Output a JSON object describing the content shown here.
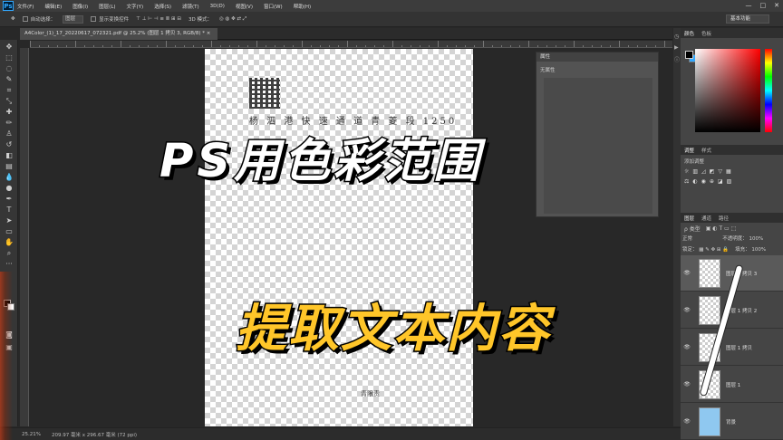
{
  "app": {
    "logo": "Ps"
  },
  "menu": [
    "文件(F)",
    "编辑(E)",
    "图像(I)",
    "图层(L)",
    "文字(Y)",
    "选择(S)",
    "滤镜(T)",
    "3D(D)",
    "视图(V)",
    "窗口(W)",
    "帮助(H)"
  ],
  "window_controls": [
    "—",
    "□",
    "✕"
  ],
  "options": {
    "auto_select": "自动选择：",
    "auto_select_value": "图层",
    "show_transform": "显示变换控件",
    "mode_3d": "3D 模式："
  },
  "workspace": "基本功能",
  "document": {
    "tab_title": "A4Color_(1)_17_20220617_072321.pdf @ 25.2% (图层 1 拷贝 3, RGB/8) *",
    "close": "×"
  },
  "doc_content": {
    "line1": "杨 泗 港 快 速 通 道 青 菱 段 1250",
    "line2": "青限责"
  },
  "properties": {
    "title": "属性",
    "body": "无属性"
  },
  "color_panel": {
    "tabs": [
      "颜色",
      "色板"
    ]
  },
  "adjust_panel": {
    "tabs": [
      "调整",
      "样式"
    ],
    "label": "添加调整"
  },
  "layers_panel": {
    "tabs": [
      "图层",
      "通道",
      "路径"
    ],
    "filter": "ρ 类型",
    "blend_mode": "正常",
    "opacity_label": "不透明度：",
    "opacity_value": "100%",
    "lock_label": "锁定：",
    "fill_label": "填充：",
    "fill_value": "100%",
    "layers": [
      {
        "name": "图层 1 拷贝 3",
        "selected": true
      },
      {
        "name": "图层 1 拷贝 2",
        "selected": false
      },
      {
        "name": "图层 1 拷贝",
        "selected": false
      },
      {
        "name": "图层 1",
        "selected": false
      },
      {
        "name": "背景",
        "selected": false
      }
    ]
  },
  "status": {
    "zoom": "25.21%",
    "doc_size": "209.97 毫米 x 296.67 毫米 (72 ppi)"
  },
  "overlay": {
    "title_line1": "PS用色彩范围",
    "title_line2": "提取文本内容"
  },
  "colors": {
    "accent": "#31a8ff",
    "title_yellow": "#ffc629"
  }
}
